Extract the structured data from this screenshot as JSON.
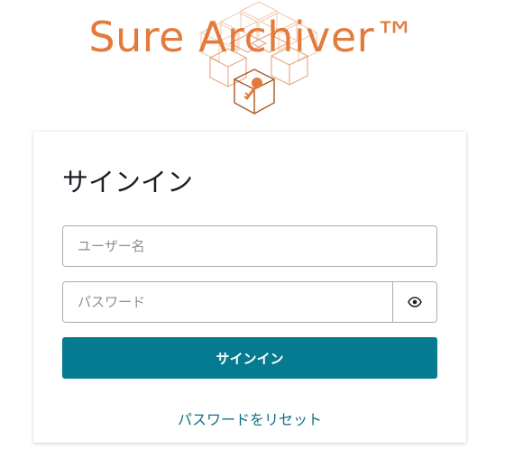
{
  "logo": {
    "text": "Sure Archiver™",
    "brand_color": "#e27b3c",
    "icon": "cube-key-icon"
  },
  "signin": {
    "title": "サインイン",
    "username_placeholder": "ユーザー名",
    "password_placeholder": "パスワード",
    "toggle_icon": "eye-icon",
    "submit_label": "サインイン",
    "submit_color": "#047b91",
    "reset_link": "パスワードをリセット"
  }
}
